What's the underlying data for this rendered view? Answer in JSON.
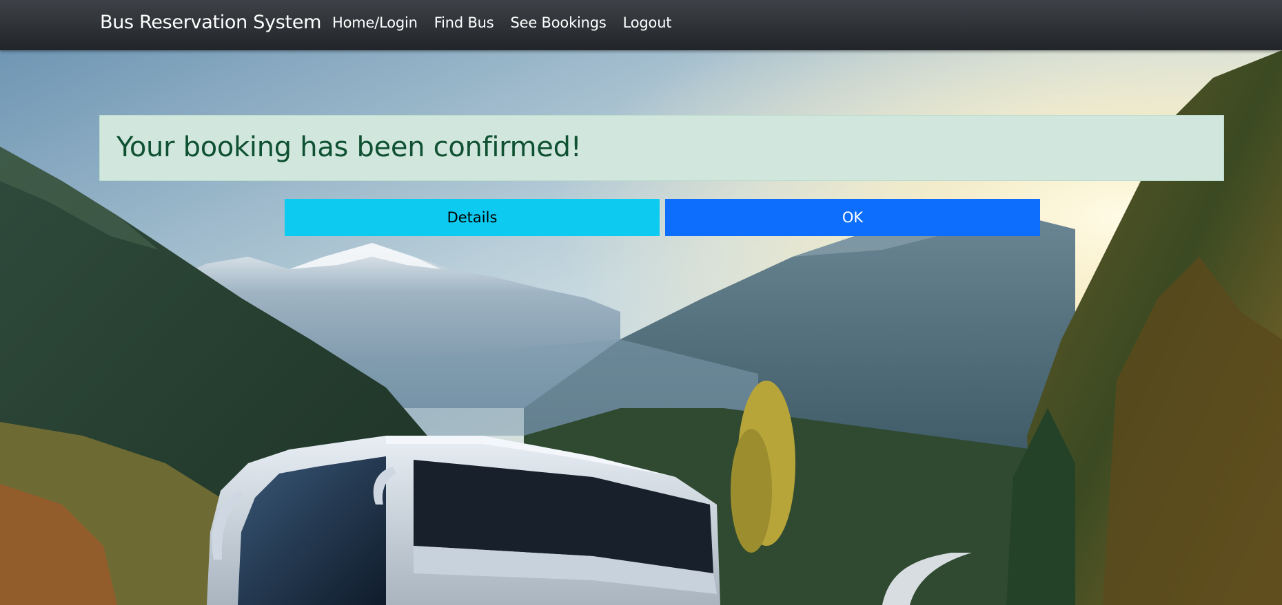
{
  "navbar": {
    "brand": "Bus Reservation System",
    "links": [
      {
        "label": "Home/Login"
      },
      {
        "label": "Find Bus"
      },
      {
        "label": "See Bookings"
      },
      {
        "label": "Logout"
      }
    ]
  },
  "alert": {
    "heading": "Your booking has been confirmed!"
  },
  "actions": {
    "details_label": "Details",
    "ok_label": "OK"
  },
  "colors": {
    "navbar": "#212529",
    "alert_bg": "#d1e7dd",
    "alert_text": "#0f5132",
    "details_button": "#0dcaf0",
    "ok_button": "#0d6efd"
  }
}
